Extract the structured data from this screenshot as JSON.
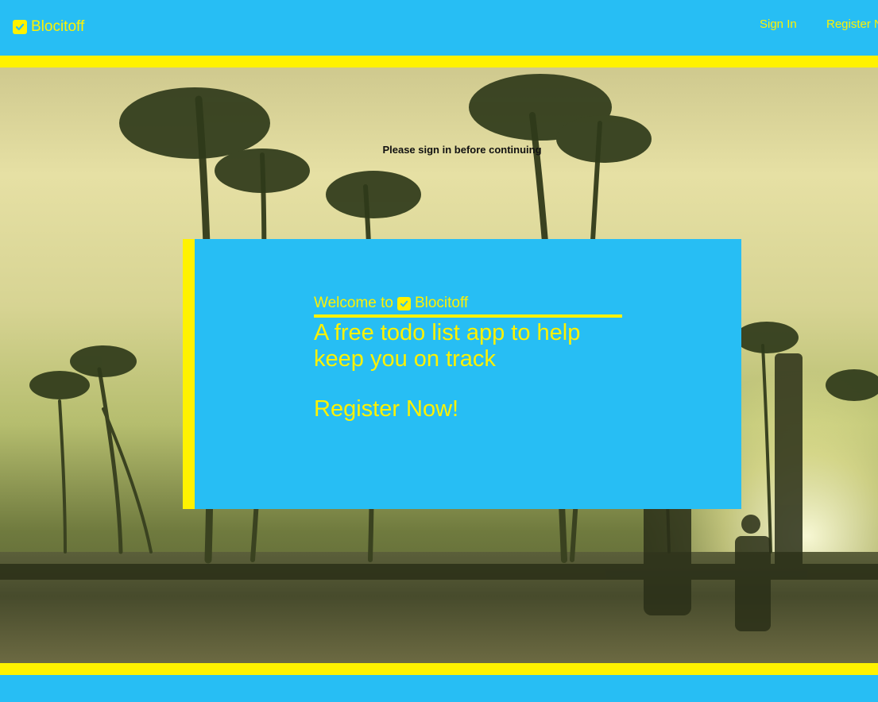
{
  "header": {
    "brand": "Blocitoff",
    "nav": {
      "sign_in": "Sign In",
      "register": "Register Now!"
    }
  },
  "flash": {
    "message": "Please sign in before continuing"
  },
  "welcome": {
    "prefix": "Welcome to",
    "brand": "Blocitoff",
    "tagline": "A free todo list app to help keep you on track",
    "cta": "Register Now!"
  },
  "colors": {
    "brand_blue": "#27bef4",
    "brand_yellow": "#fff200"
  },
  "icons": {
    "brand_logo": "check-box-icon"
  }
}
